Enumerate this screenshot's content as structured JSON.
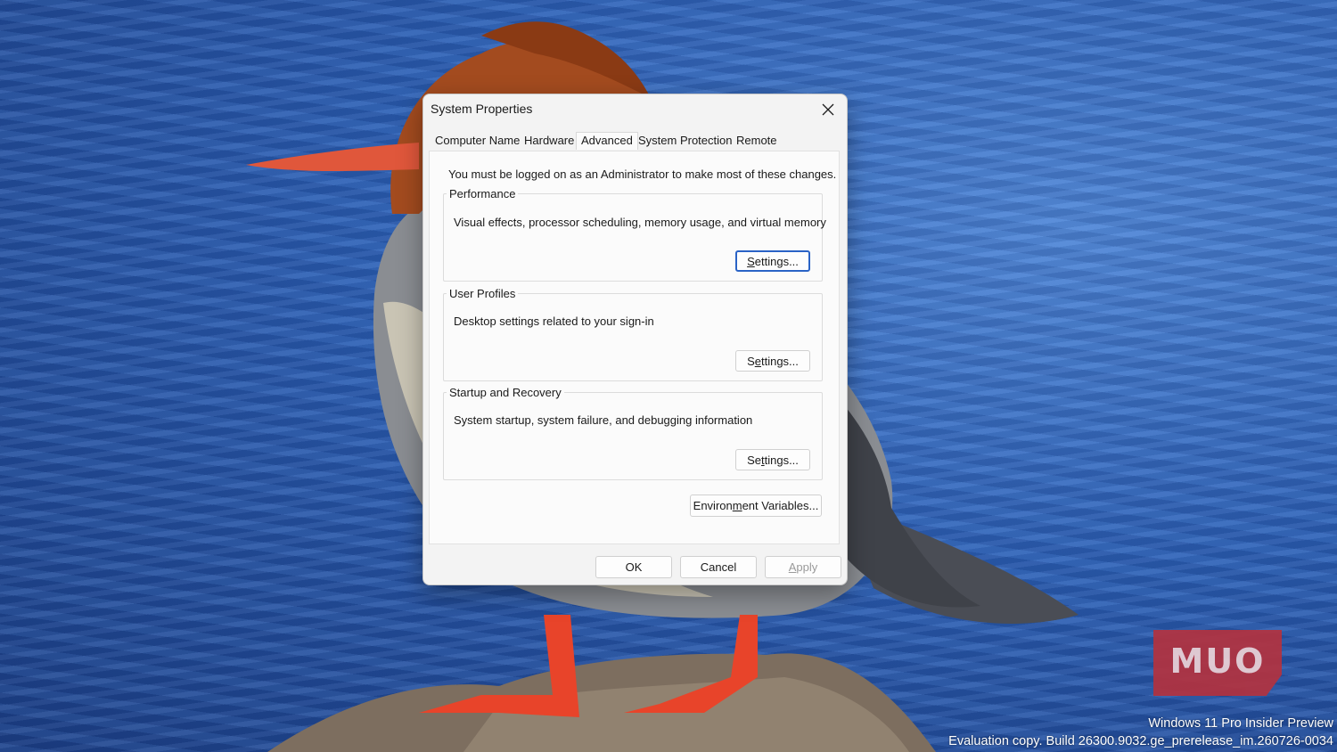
{
  "dialog": {
    "title": "System Properties",
    "tabs": [
      {
        "label": "Computer Name",
        "active": false
      },
      {
        "label": "Hardware",
        "active": false
      },
      {
        "label": "Advanced",
        "active": true
      },
      {
        "label": "System Protection",
        "active": false
      },
      {
        "label": "Remote",
        "active": false
      }
    ],
    "admin_note": "You must be logged on as an Administrator to make most of these changes.",
    "groups": {
      "performance": {
        "legend": "Performance",
        "description": "Visual effects, processor scheduling, memory usage, and virtual memory",
        "button": {
          "before": "",
          "access_key": "S",
          "after": "ettings..."
        }
      },
      "user_profiles": {
        "legend": "User Profiles",
        "description": "Desktop settings related to your sign-in",
        "button": {
          "before": "S",
          "access_key": "e",
          "after": "ttings..."
        }
      },
      "startup_recovery": {
        "legend": "Startup and Recovery",
        "description": "System startup, system failure, and debugging information",
        "button": {
          "before": "Se",
          "access_key": "t",
          "after": "tings..."
        }
      }
    },
    "env_button": {
      "before": "Environ",
      "access_key": "m",
      "after": "ent Variables..."
    },
    "footer": {
      "ok": "OK",
      "cancel": "Cancel",
      "apply": {
        "before": "",
        "access_key": "A",
        "after": "pply"
      }
    }
  },
  "watermark": {
    "logo": "MUO",
    "os_line1": "Windows 11 Pro Insider Preview",
    "os_line2": "Evaluation copy. Build 26300.9032.ge_prerelease_im.260726-0034"
  },
  "colors": {
    "accent_focus": "#2a63c6",
    "logo_bg": "#b3323f",
    "dialog_bg": "#f3f3f3"
  }
}
